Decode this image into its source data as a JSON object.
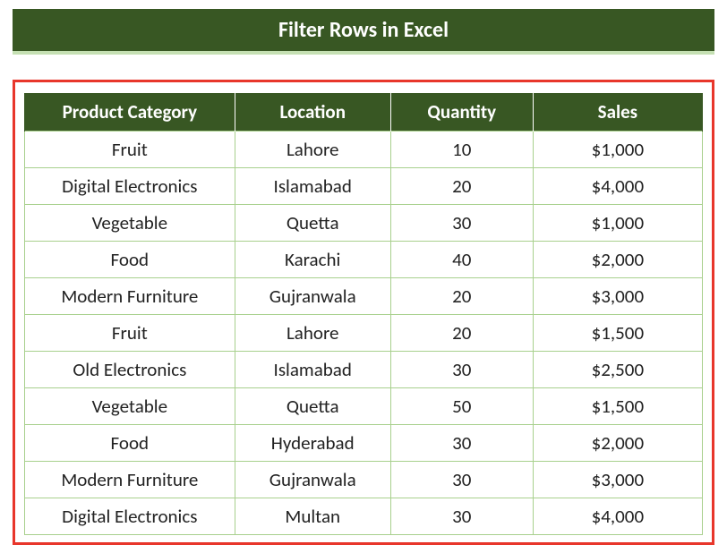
{
  "title": "Filter Rows in Excel",
  "headers": {
    "category": "Product Category",
    "location": "Location",
    "quantity": "Quantity",
    "sales": "Sales"
  },
  "rows": [
    {
      "category": "Fruit",
      "location": "Lahore",
      "quantity": "10",
      "sales": "$1,000"
    },
    {
      "category": "Digital Electronics",
      "location": "Islamabad",
      "quantity": "20",
      "sales": "$4,000"
    },
    {
      "category": "Vegetable",
      "location": "Quetta",
      "quantity": "30",
      "sales": "$1,000"
    },
    {
      "category": "Food",
      "location": "Karachi",
      "quantity": "40",
      "sales": "$2,000"
    },
    {
      "category": "Modern Furniture",
      "location": "Gujranwala",
      "quantity": "20",
      "sales": "$3,000"
    },
    {
      "category": "Fruit",
      "location": "Lahore",
      "quantity": "20",
      "sales": "$1,500"
    },
    {
      "category": "Old Electronics",
      "location": "Islamabad",
      "quantity": "30",
      "sales": "$2,500"
    },
    {
      "category": "Vegetable",
      "location": "Quetta",
      "quantity": "50",
      "sales": "$1,500"
    },
    {
      "category": "Food",
      "location": "Hyderabad",
      "quantity": "30",
      "sales": "$2,000"
    },
    {
      "category": "Modern Furniture",
      "location": "Gujranwala",
      "quantity": "30",
      "sales": "$3,000"
    },
    {
      "category": "Digital Electronics",
      "location": "Multan",
      "quantity": "30",
      "sales": "$4,000"
    }
  ]
}
